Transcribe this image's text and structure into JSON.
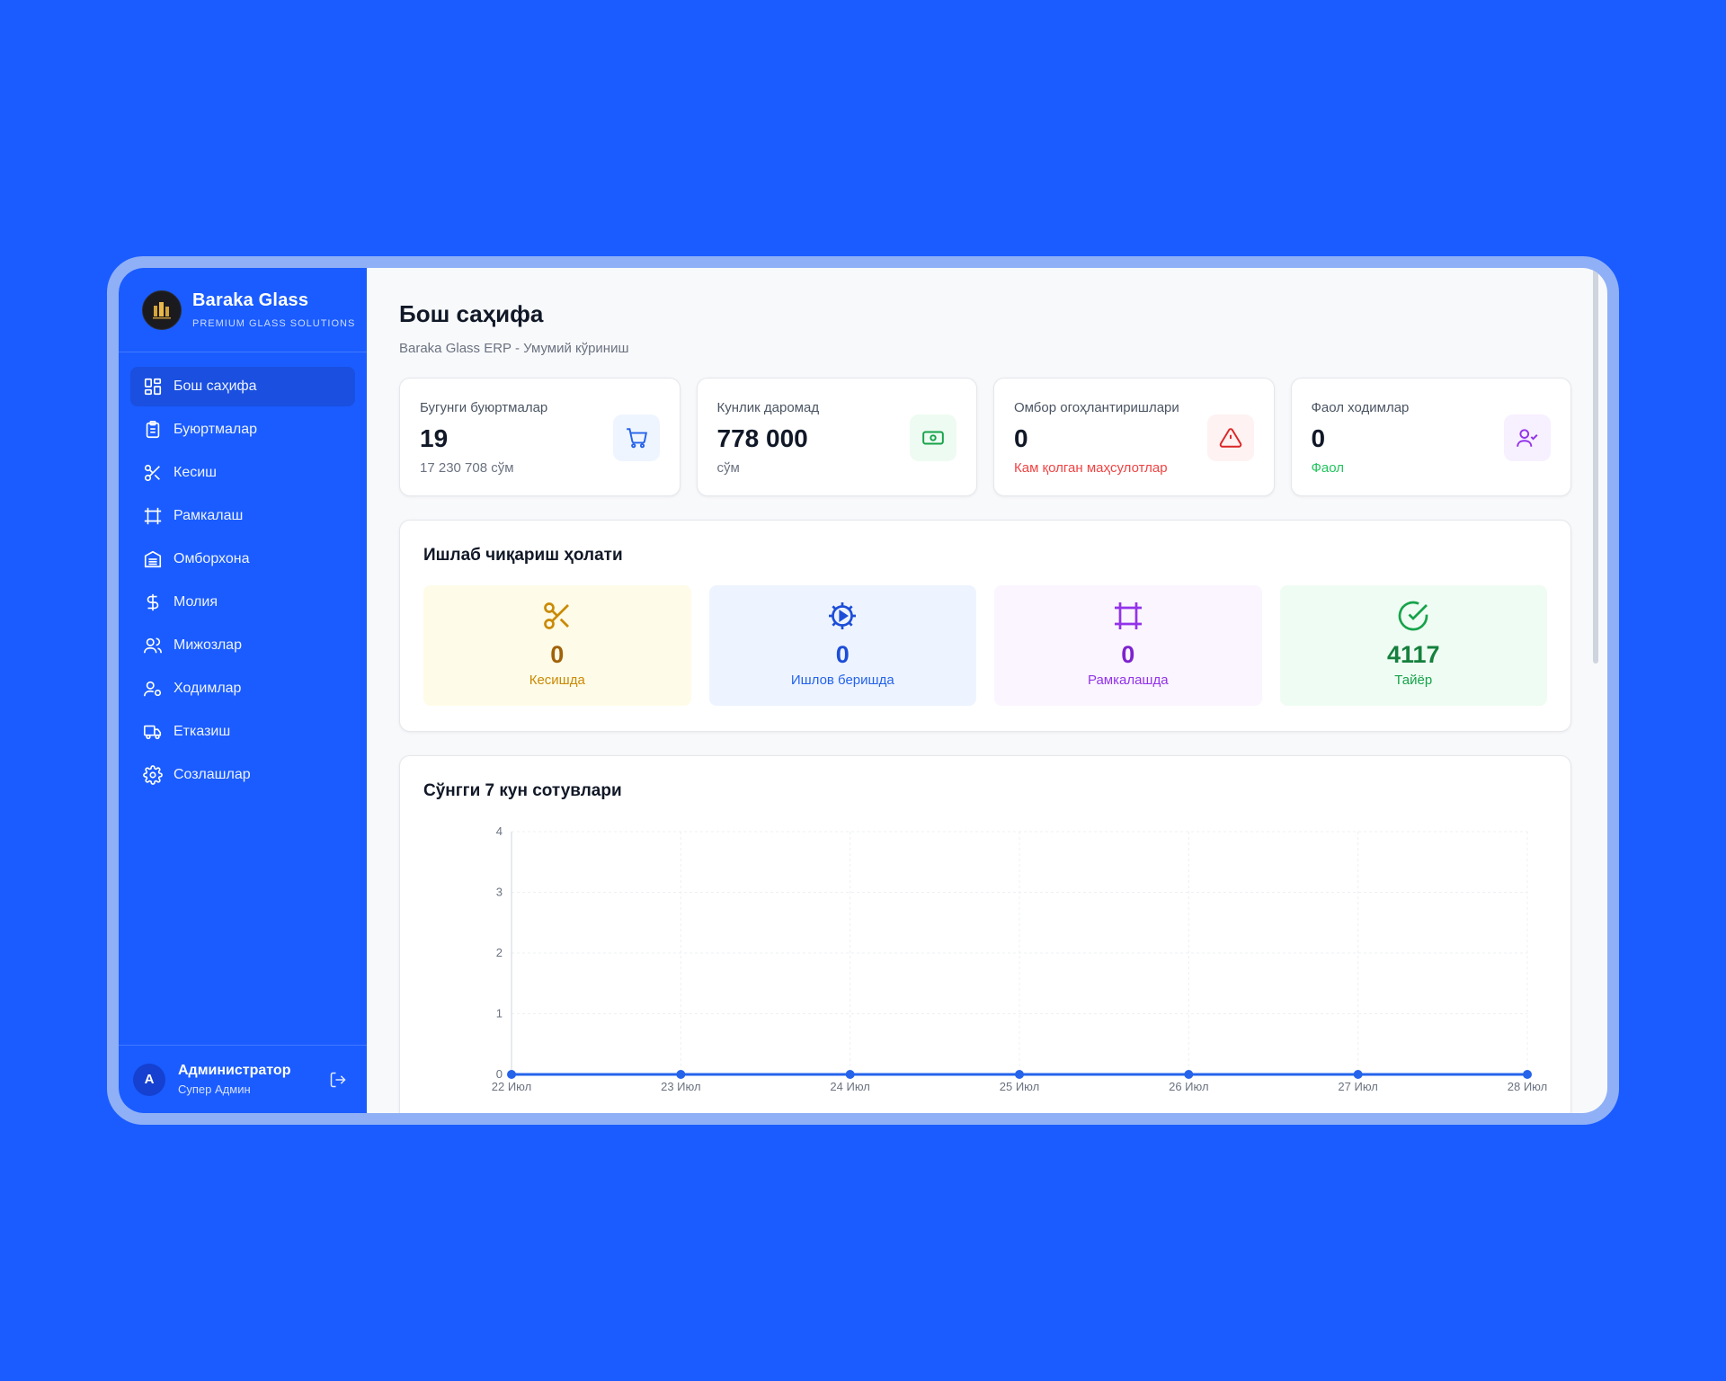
{
  "brand": {
    "title": "Baraka Glass",
    "subtitle": "PREMIUM GLASS SOLUTIONS"
  },
  "sidebar": {
    "items": [
      {
        "label": "Бош саҳифа",
        "icon": "dashboard-icon",
        "active": true
      },
      {
        "label": "Буюртмалар",
        "icon": "clipboard-icon"
      },
      {
        "label": "Кесиш",
        "icon": "scissors-icon"
      },
      {
        "label": "Рамкалаш",
        "icon": "frame-icon"
      },
      {
        "label": "Омборхона",
        "icon": "warehouse-icon"
      },
      {
        "label": "Молия",
        "icon": "dollar-icon"
      },
      {
        "label": "Мижозлар",
        "icon": "users-icon"
      },
      {
        "label": "Ходимлар",
        "icon": "user-cog-icon"
      },
      {
        "label": "Етказиш",
        "icon": "truck-icon"
      },
      {
        "label": "Созлашлар",
        "icon": "gear-icon"
      }
    ]
  },
  "user": {
    "initial": "A",
    "name": "Администратор",
    "role": "Супер Админ"
  },
  "page": {
    "title": "Бош саҳифа",
    "subtitle": "Baraka Glass ERP - Умумий кўриниш"
  },
  "stats": [
    {
      "label": "Бугунги буюртмалар",
      "value": "19",
      "note": "17 230 708 сўм",
      "icon": "cart-icon",
      "color": "#2563eb",
      "bg": "#eff5ff",
      "note_color": "#6b7280"
    },
    {
      "label": "Кунлик даромад",
      "value": "778 000",
      "note": "сўм",
      "icon": "cash-icon",
      "color": "#16a34a",
      "bg": "#eefbf2",
      "note_color": "#6b7280"
    },
    {
      "label": "Омбор огоҳлантиришлари",
      "value": "0",
      "note": "Кам қолган маҳсулотлар",
      "icon": "alert-icon",
      "color": "#dc2626",
      "bg": "#fef2f2",
      "note_color": "#ef4444"
    },
    {
      "label": "Фаол ходимлар",
      "value": "0",
      "note": "Фаол",
      "icon": "user-check-icon",
      "color": "#9333ea",
      "bg": "#f7f0ff",
      "note_color": "#22c55e"
    }
  ],
  "production": {
    "title": "Ишлаб чиқариш ҳолати",
    "items": [
      {
        "value": "0",
        "label": "Кесишда",
        "icon": "scissors-icon",
        "color": "#ca8a04",
        "bg": "#fefbe8"
      },
      {
        "value": "0",
        "label": "Ишлов беришда",
        "icon": "cog-play-icon",
        "color": "#1d4ed8",
        "bg": "#eef4ff"
      },
      {
        "value": "0",
        "label": "Рамкалашда",
        "icon": "frame-icon",
        "color": "#9333ea",
        "bg": "#faf5ff"
      },
      {
        "value": "4117",
        "label": "Тайёр",
        "icon": "check-circle-icon",
        "color": "#15803d",
        "bg": "#effcf3"
      }
    ]
  },
  "sales": {
    "title": "Сўнгги 7 кун сотувлари"
  },
  "chart_data": {
    "type": "line",
    "title": "Сўнгги 7 кун сотувлари",
    "x": [
      "22 Июл",
      "23 Июл",
      "24 Июл",
      "25 Июл",
      "26 Июл",
      "27 Июл",
      "28 Июл"
    ],
    "series": [
      {
        "values": [
          0,
          0,
          0,
          0,
          0,
          0,
          0
        ]
      }
    ],
    "y_ticks": [
      0,
      1,
      2,
      3,
      4
    ],
    "ylim": [
      0,
      4
    ],
    "grid": true,
    "color": "#2563eb"
  }
}
